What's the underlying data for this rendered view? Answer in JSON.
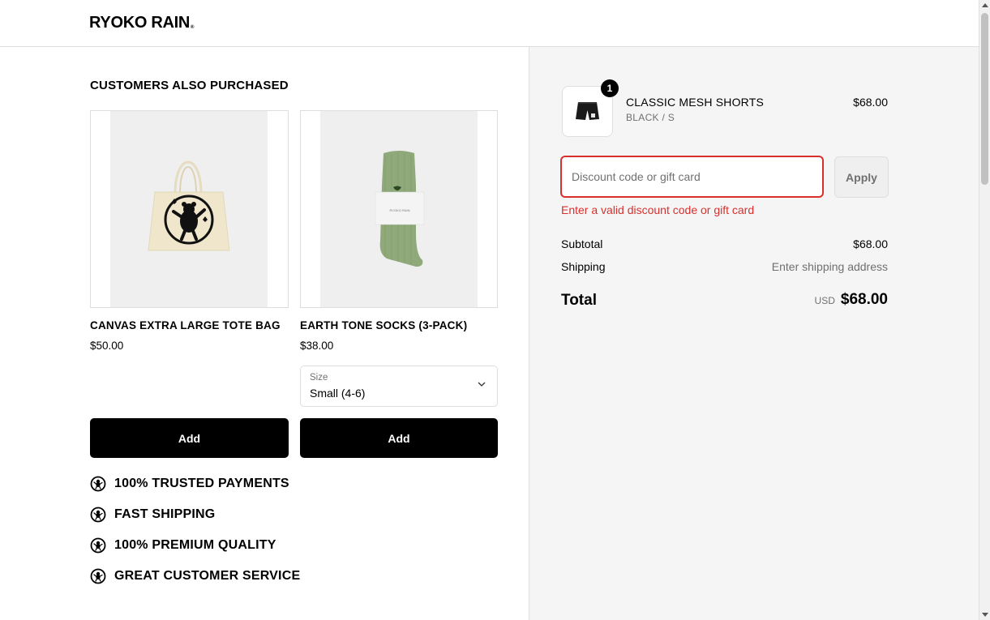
{
  "header": {
    "logo_text": "RYOKO RAIN",
    "logo_mark": "®"
  },
  "upsell": {
    "title": "CUSTOMERS ALSO PURCHASED",
    "products": [
      {
        "name": "CANVAS EXTRA LARGE TOTE BAG",
        "price": "$50.00",
        "add_label": "Add",
        "image_icon": "tote-bag-image"
      },
      {
        "name": "EARTH TONE SOCKS (3-PACK)",
        "price": "$38.00",
        "add_label": "Add",
        "image_icon": "socks-image",
        "size_select": {
          "label": "Size",
          "value": "Small (4-6)"
        }
      }
    ]
  },
  "trust_badges": [
    {
      "label": "100% TRUSTED PAYMENTS",
      "icon": "bear-badge-icon"
    },
    {
      "label": "FAST SHIPPING",
      "icon": "bear-badge-icon"
    },
    {
      "label": "100% PREMIUM QUALITY",
      "icon": "bear-badge-icon"
    },
    {
      "label": "GREAT CUSTOMER SERVICE",
      "icon": "bear-badge-icon"
    }
  ],
  "order_summary": {
    "item": {
      "quantity": "1",
      "name": "CLASSIC MESH SHORTS",
      "variant": "BLACK / S",
      "price": "$68.00",
      "image_icon": "shorts-thumbnail"
    },
    "discount": {
      "placeholder": "Discount code or gift card",
      "value": "",
      "apply_label": "Apply",
      "error": "Enter a valid discount code or gift card"
    },
    "subtotal_label": "Subtotal",
    "subtotal_value": "$68.00",
    "shipping_label": "Shipping",
    "shipping_value": "Enter shipping address",
    "total_label": "Total",
    "currency": "USD",
    "total_value": "$68.00"
  },
  "colors": {
    "error": "#d8302d",
    "button": "#000000",
    "summary_bg": "#f5f5f5",
    "sock_green": "#8fa97a"
  }
}
